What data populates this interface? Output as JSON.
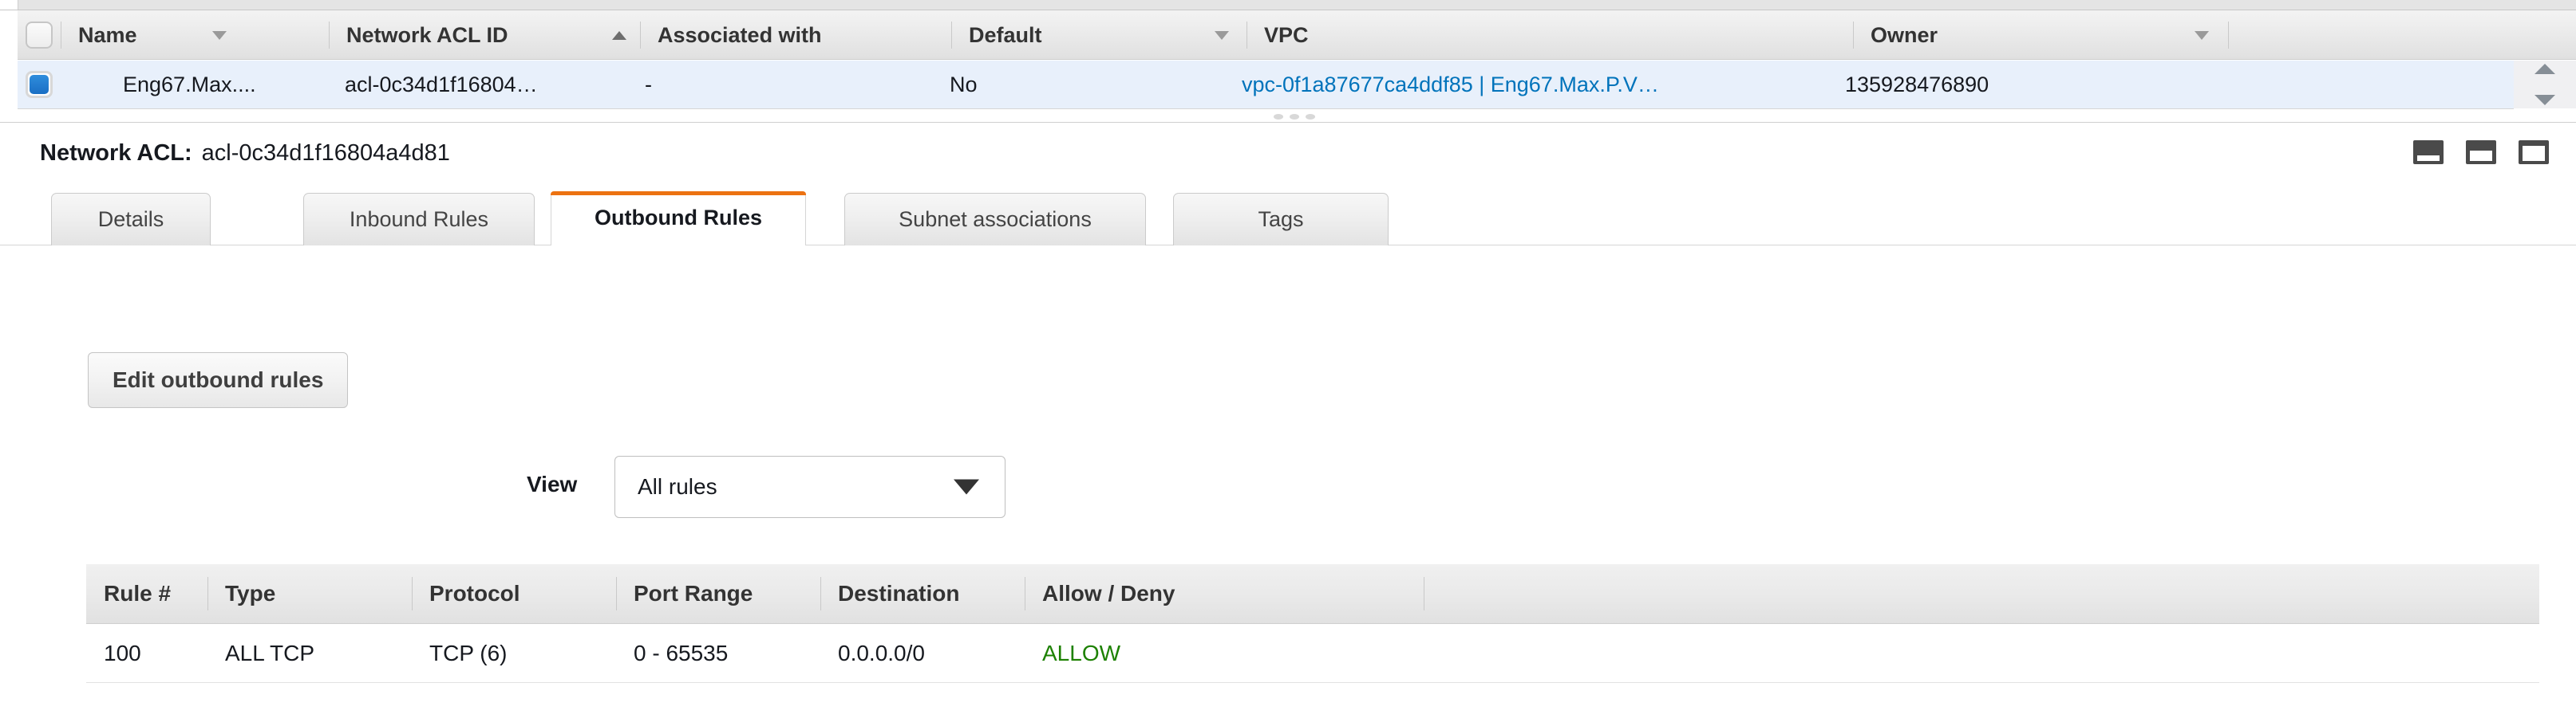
{
  "resource_table": {
    "columns": [
      {
        "label": "Name",
        "sort": "down"
      },
      {
        "label": "Network ACL ID",
        "sort": "up"
      },
      {
        "label": "Associated with",
        "sort": "none"
      },
      {
        "label": "Default",
        "sort": "down"
      },
      {
        "label": "VPC",
        "sort": "none"
      },
      {
        "label": "Owner",
        "sort": "down"
      }
    ],
    "rows": [
      {
        "selected": true,
        "name": "Eng67.Max....",
        "acl_id": "acl-0c34d1f16804…",
        "associated_with": "-",
        "default": "No",
        "vpc": "vpc-0f1a87677ca4ddf85 | Eng67.Max.P.V…",
        "owner": "135928476890"
      }
    ],
    "scroll": {
      "up_icon": "chevron-up-icon",
      "down_icon": "chevron-down-icon"
    }
  },
  "detail": {
    "title_label": "Network ACL:",
    "title_value": "acl-0c34d1f16804a4d81",
    "panel_icons": [
      "panel-size-small-icon",
      "panel-size-medium-icon",
      "panel-size-large-icon"
    ],
    "tabs": [
      {
        "label": "Details",
        "active": false
      },
      {
        "label": "Inbound Rules",
        "active": false
      },
      {
        "label": "Outbound Rules",
        "active": true
      },
      {
        "label": "Subnet associations",
        "active": false
      },
      {
        "label": "Tags",
        "active": false
      }
    ]
  },
  "outbound": {
    "edit_button": "Edit outbound rules",
    "view_label": "View",
    "view_value": "All rules",
    "view_options": [
      "All rules"
    ],
    "columns": [
      "Rule #",
      "Type",
      "Protocol",
      "Port Range",
      "Destination",
      "Allow / Deny"
    ],
    "rows": [
      {
        "rule": "100",
        "type": "ALL TCP",
        "protocol": "TCP (6)",
        "port_range": "0 - 65535",
        "destination": "0.0.0.0/0",
        "allow_deny": "ALLOW"
      }
    ]
  },
  "colors": {
    "accent_orange": "#ec7211",
    "link_blue": "#0073bb",
    "allow_green": "#1d8102",
    "row_selected_bg": "#e8f0fb"
  }
}
